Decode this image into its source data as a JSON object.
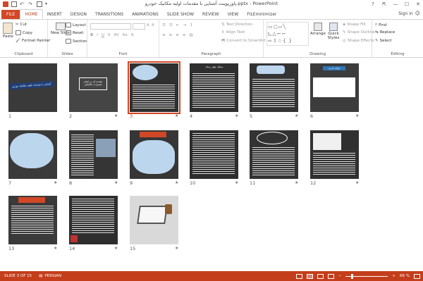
{
  "window": {
    "title": "پاورپوینت آشنایی با مقدمات اولیه مکانیک خودرو.pptx - PowerPoint",
    "minimize": "—",
    "maximize": "☐",
    "close": "✕",
    "help": "?"
  },
  "tabs": [
    {
      "label": "FILE"
    },
    {
      "label": "HOME"
    },
    {
      "label": "INSERT"
    },
    {
      "label": "DESIGN"
    },
    {
      "label": "TRANSITIONS"
    },
    {
      "label": "ANIMATIONS"
    },
    {
      "label": "SLIDE SHOW"
    },
    {
      "label": "REVIEW"
    },
    {
      "label": "VIEW"
    },
    {
      "label": "FILEminimizer"
    }
  ],
  "signin": "Sign in",
  "ribbon": {
    "clipboard": {
      "label": "Clipboard",
      "paste": "Paste",
      "cut": "Cut",
      "copy": "Copy",
      "format_painter": "Format Painter"
    },
    "slides": {
      "label": "Slides",
      "new_slide": "New Slide",
      "layout": "Layout",
      "reset": "Reset",
      "section": "Section"
    },
    "font": {
      "label": "Font"
    },
    "paragraph": {
      "label": "Paragraph",
      "text_direction": "Text Direction",
      "align_text": "Align Text",
      "convert": "Convert to SmartArt"
    },
    "drawing": {
      "label": "Drawing",
      "arrange": "Arrange",
      "quick_styles": "Quick Styles",
      "shape_fill": "Shape Fill",
      "shape_outline": "Shape Outline",
      "shape_effects": "Shape Effects"
    },
    "editing": {
      "label": "Editing",
      "find": "Find",
      "replace": "Replace",
      "select": "Select"
    }
  },
  "slides": [
    {
      "num": "1",
      "title": "آشنایی با مقدمات اولیه مکانیک خودرو",
      "star": ""
    },
    {
      "num": "2",
      "title": "مقدمه ای بر انجام تعمیرات مکانیکی",
      "star": "★"
    },
    {
      "num": "3",
      "title": "",
      "star": "★"
    },
    {
      "num": "4",
      "title": "سیکل چهار زمانه",
      "star": "★"
    },
    {
      "num": "5",
      "title": "",
      "star": "★"
    },
    {
      "num": "6",
      "title": "بلوکه کردن",
      "star": "★"
    },
    {
      "num": "7",
      "title": "",
      "star": "★"
    },
    {
      "num": "8",
      "title": "",
      "star": "★"
    },
    {
      "num": "9",
      "title": "",
      "star": "★"
    },
    {
      "num": "10",
      "title": "",
      "star": "★"
    },
    {
      "num": "11",
      "title": "",
      "star": "★"
    },
    {
      "num": "12",
      "title": "",
      "star": "★"
    },
    {
      "num": "13",
      "title": "",
      "star": "★"
    },
    {
      "num": "14",
      "title": "",
      "star": "★"
    },
    {
      "num": "15",
      "title": "",
      "star": "★"
    }
  ],
  "status": {
    "slide_info": "SLIDE 3 OF 15",
    "language": "PERSIAN",
    "zoom": "66 %",
    "zoom_value": 66
  },
  "colors": {
    "accent": "#c43e1c",
    "file_tab": "#d24726"
  }
}
